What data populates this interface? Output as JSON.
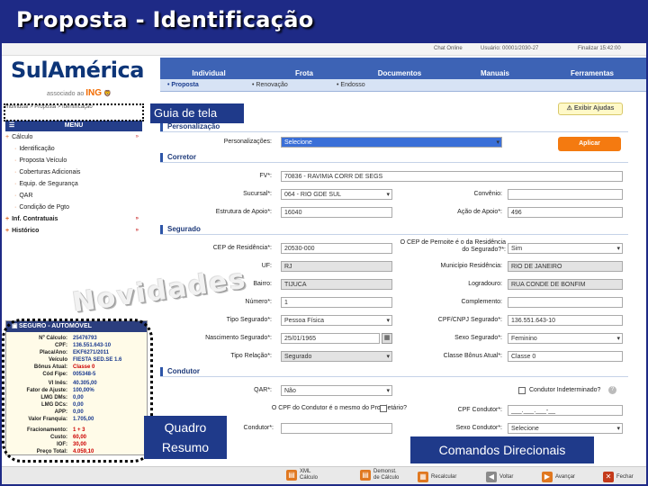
{
  "slide": {
    "title": "Proposta - Identificação"
  },
  "topbar": {
    "chat": "Chat Online",
    "user": "Usuário: 00001/2030-27",
    "finish": "Finalizar 15:42:00"
  },
  "brand": {
    "name": "SulAmérica",
    "associated": "associado ao",
    "ing": "ING"
  },
  "tabs": [
    "Individual",
    "Frota",
    "Documentos",
    "Manuais",
    "Ferramentas"
  ],
  "subtabs": [
    "Proposta",
    "Renovação",
    "Endosso"
  ],
  "breadcrumb": "Individual > Proposta > Identificação",
  "menu": {
    "header": "MENU",
    "items": [
      "Cálculo",
      "Identificação",
      "Proposta Veículo",
      "Coberturas Adicionais",
      "Equip. de Segurança",
      "QAR",
      "Condição de Pgto",
      "Inf. Contratuais",
      "Histórico"
    ]
  },
  "summary": {
    "header": "SEGURO - AUTOMÓVEL",
    "rows": [
      {
        "k": "Nº Cálculo:",
        "v": "25476793"
      },
      {
        "k": "CPF:",
        "v": "136.551.643-10"
      },
      {
        "k": "Placa/Ano:",
        "v": "EKF6271/2011"
      },
      {
        "k": "Veículo",
        "v": "FIESTA SED.SE 1.6"
      },
      {
        "k": "Bônus Atual:",
        "v": "Classe 0"
      },
      {
        "k": "Cód Fipe:",
        "v": "005348-5"
      },
      {
        "k": "VI Inês:",
        "v": "40.305,00"
      },
      {
        "k": "Fator de Ajuste:",
        "v": "100,00%"
      },
      {
        "k": "LMG DMs:",
        "v": "0,00"
      },
      {
        "k": "LMG DCs:",
        "v": "0,00"
      },
      {
        "k": "APP:",
        "v": "0,00"
      },
      {
        "k": "Valor Franquia:",
        "v": "1.705,00"
      },
      {
        "k": "Fracionamento:",
        "v": "1 + 3"
      },
      {
        "k": "Custo:",
        "v": "60,00"
      },
      {
        "k": "IOF:",
        "v": "30,00"
      },
      {
        "k": "Preço Total:",
        "v": "4.059,10"
      }
    ]
  },
  "novidades": "Novidades",
  "guide": {
    "label": "Guia de tela",
    "exibir_ajudas": "Exibir Ajudas"
  },
  "personalizacao": {
    "section": "Personalização",
    "label": "Personalizações:",
    "value": "Selecione",
    "button": "Aplicar"
  },
  "corretor": {
    "section": "Corretor",
    "susep_label": "FV*:",
    "susep_value": "70836 - RAVIMIA CORR DE SEGS",
    "sucursal_label": "Sucursal*:",
    "sucursal_value": "064 - RIO GDE SUL",
    "convenio_label": "Convênio:",
    "estrutura_label": "Estrutura de Apoio*:",
    "estrutura_value": "16040",
    "acao_label": "Ação de Apoio*:",
    "acao_value": "496"
  },
  "segurado": {
    "section": "Segurado",
    "cep_label": "CEP de Residência*:",
    "cep_value": "20530-000",
    "cep_pernoite_label": "O CEP de Pernoite é o da Residência do Segurado?*:",
    "cep_pernoite_value": "Sim",
    "uf_label": "UF:",
    "uf_value": "RJ",
    "municipio_label": "Município Residência:",
    "municipio_value": "RIO DE JANEIRO",
    "bairro_label": "Bairro:",
    "bairro_value": "TIJUCA",
    "logradouro_label": "Logradouro:",
    "logradouro_value": "RUA CONDE DE BONFIM",
    "numero_label": "Número*:",
    "numero_value": "1",
    "complemento_label": "Complemento:",
    "tipo_label": "Tipo Segurado*:",
    "tipo_value": "Pessoa Física",
    "cpf_label": "CPF/CNPJ Segurado*:",
    "cpf_value": "136.551.643-10",
    "nasc_label": "Nascimento Segurado*:",
    "nasc_value": "25/01/1965",
    "sexo_label": "Sexo Segurado*:",
    "sexo_value": "Feminino",
    "relacao_label": "Tipo Relação*:",
    "relacao_value": "Segurado",
    "classe_label": "Classe Bônus Atual*:",
    "classe_value": "Classe 0"
  },
  "condutor": {
    "section": "Condutor",
    "qar_label": "QAR*:",
    "qar_value": "Não",
    "indeterminado_label": "Condutor Indeterminado?",
    "mesmo_label": "O CPF do Condutor é o mesmo do Proprietário?",
    "cpf_label": "CPF Condutor*:",
    "cpf_value": "___.___.___-__",
    "nome_label": "Condutor*:",
    "sexo_label": "Sexo Condutor*:",
    "sexo_value": "Selecione"
  },
  "overlays": {
    "quadro_line1": "Quadro",
    "quadro_line2": "Resumo",
    "comandos": "Comandos Direcionais"
  },
  "bottombar": {
    "xml_line1": "XML",
    "xml_line2": "Cálculo",
    "demonst_line1": "Demonst.",
    "demonst_line2": "de Cálculo",
    "recalcular": "Recalcular",
    "voltar": "Voltar",
    "avancar": "Avançar",
    "fechar": "Fechar"
  }
}
